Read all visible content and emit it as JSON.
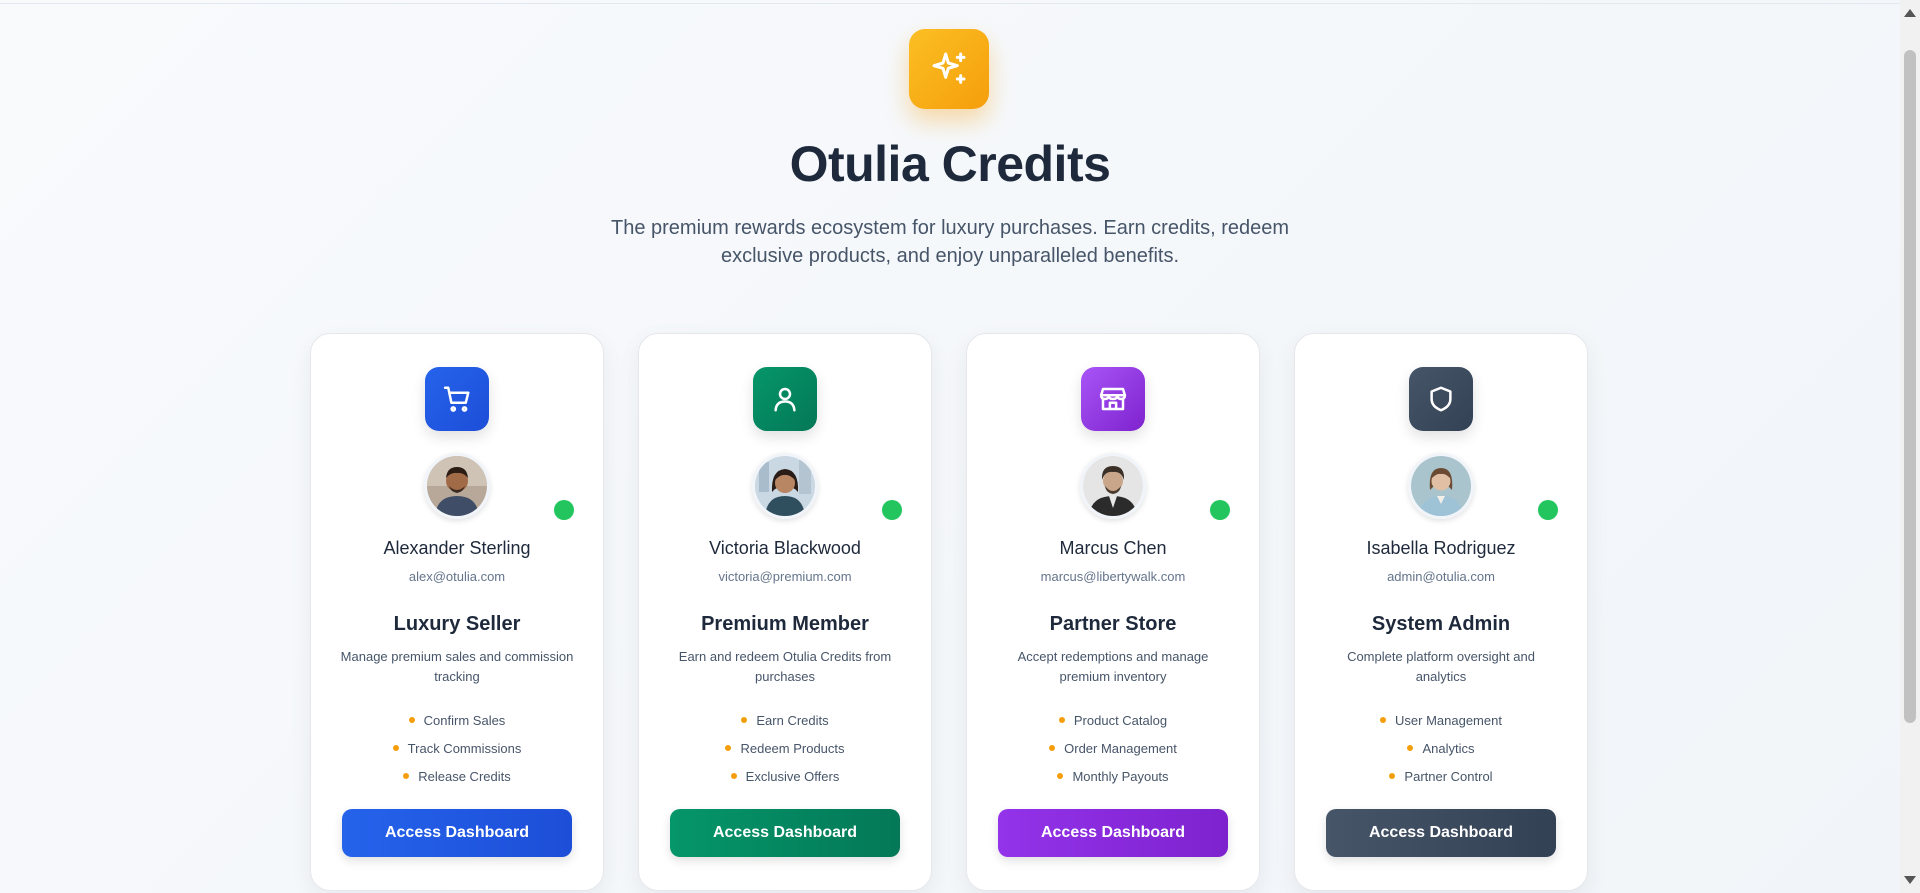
{
  "hero": {
    "icon": "sparkles-icon",
    "title": "Otulia Credits",
    "subtitle": "The premium rewards ecosystem for luxury purchases. Earn credits, redeem exclusive products, and enjoy unparalleled benefits."
  },
  "colors": {
    "accent": "#f59e0b",
    "status_online": "#22c55e"
  },
  "cards": [
    {
      "role_icon": "shopping-cart-icon",
      "icon_color": "#2563eb",
      "name": "Alexander Sterling",
      "email": "alex@otulia.com",
      "role": "Luxury Seller",
      "description": "Manage premium sales and commission tracking",
      "features": [
        "Confirm Sales",
        "Track Commissions",
        "Release Credits"
      ],
      "button": "Access Dashboard",
      "button_color": "#2563eb"
    },
    {
      "role_icon": "user-icon",
      "icon_color": "#059669",
      "name": "Victoria Blackwood",
      "email": "victoria@premium.com",
      "role": "Premium Member",
      "description": "Earn and redeem Otulia Credits from purchases",
      "features": [
        "Earn Credits",
        "Redeem Products",
        "Exclusive Offers"
      ],
      "button": "Access Dashboard",
      "button_color": "#059669"
    },
    {
      "role_icon": "store-icon",
      "icon_color": "#9333ea",
      "name": "Marcus Chen",
      "email": "marcus@libertywalk.com",
      "role": "Partner Store",
      "description": "Accept redemptions and manage premium inventory",
      "features": [
        "Product Catalog",
        "Order Management",
        "Monthly Payouts"
      ],
      "button": "Access Dashboard",
      "button_color": "#9333ea"
    },
    {
      "role_icon": "shield-icon",
      "icon_color": "#334155",
      "name": "Isabella Rodriguez",
      "email": "admin@otulia.com",
      "role": "System Admin",
      "description": "Complete platform oversight and analytics",
      "features": [
        "User Management",
        "Analytics",
        "Partner Control"
      ],
      "button": "Access Dashboard",
      "button_color": "#334155"
    }
  ]
}
